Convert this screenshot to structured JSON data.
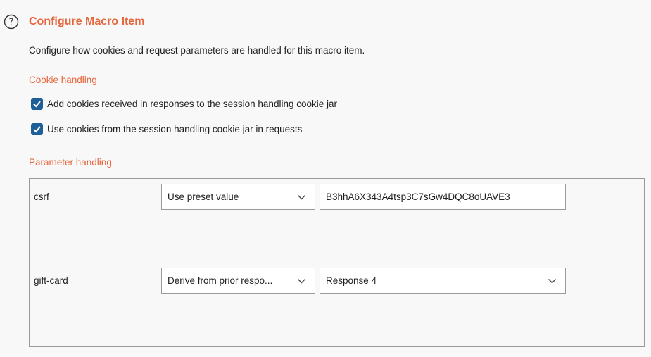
{
  "header": {
    "title": "Configure Macro Item",
    "description": "Configure how cookies and request parameters are handled for this macro item."
  },
  "cookie_handling": {
    "section_title": "Cookie handling",
    "options": [
      {
        "label": "Add cookies received in responses to the session handling cookie jar",
        "checked": true
      },
      {
        "label": "Use cookies from the session handling cookie jar in requests",
        "checked": true
      }
    ]
  },
  "parameter_handling": {
    "section_title": "Parameter handling",
    "params": [
      {
        "name": "csrf",
        "mode": "Use preset value",
        "value": "B3hhA6X343A4tsp3C7sGw4DQC8oUAVE3"
      },
      {
        "name": "gift-card",
        "mode": "Derive from prior respo...",
        "value": "Response 4"
      }
    ]
  },
  "colors": {
    "accent": "#e8643a",
    "checkbox": "#1f5f98"
  }
}
